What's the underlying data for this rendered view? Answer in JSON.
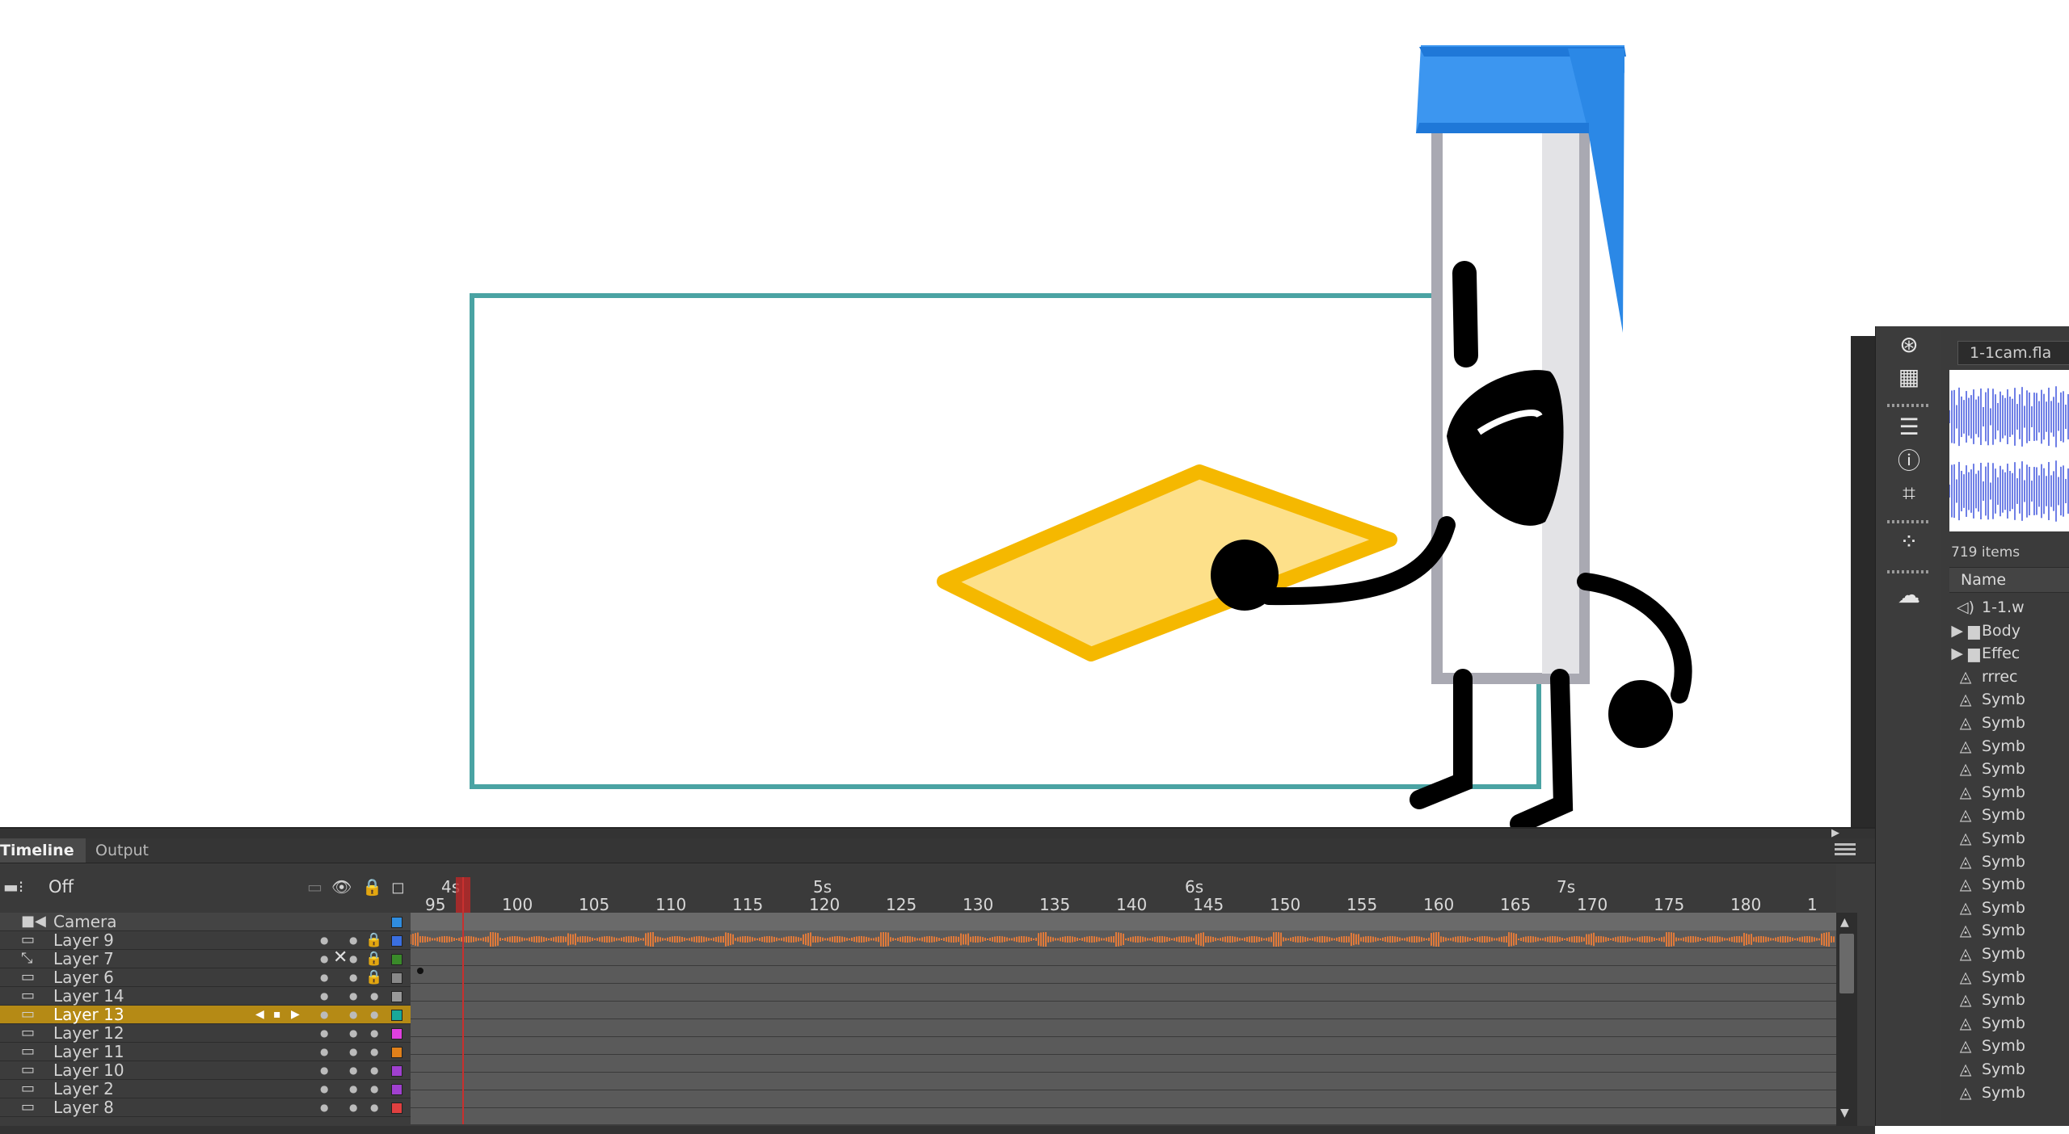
{
  "timeline": {
    "tabs": [
      "Timeline",
      "Output"
    ],
    "camera_toggle": "Off",
    "seconds_labels": [
      "4s",
      "5s",
      "6s",
      "7s"
    ],
    "frame_labels": [
      "95",
      "100",
      "105",
      "110",
      "115",
      "120",
      "125",
      "130",
      "135",
      "140",
      "145",
      "150",
      "155",
      "160",
      "165",
      "170",
      "175",
      "180",
      "1"
    ],
    "layers": [
      {
        "name": "Camera",
        "color": "#2f8de0"
      },
      {
        "name": "Layer 9",
        "color": "#3a6fe0"
      },
      {
        "name": "Layer 7",
        "color": "#3a8a2a"
      },
      {
        "name": "Layer 6",
        "color": "#888888"
      },
      {
        "name": "Layer 14",
        "color": "#999999"
      },
      {
        "name": "Layer 13",
        "color": "#19a89a"
      },
      {
        "name": "Layer 12",
        "color": "#e040e0"
      },
      {
        "name": "Layer 11",
        "color": "#e0801a"
      },
      {
        "name": "Layer 10",
        "color": "#a040d0"
      },
      {
        "name": "Layer 2",
        "color": "#a040d0"
      },
      {
        "name": "Layer 8",
        "color": "#e04040"
      }
    ],
    "selected_layer": "Layer 13"
  },
  "library": {
    "file_name": "1-1cam.fla",
    "item_count": "719 items",
    "name_header": "Name",
    "items": [
      {
        "icon": "sound-icon",
        "label": "1-1.w"
      },
      {
        "icon": "folder-icon",
        "label": "Body"
      },
      {
        "icon": "folder-icon",
        "label": "Effec"
      },
      {
        "icon": "graphic-symbol-icon",
        "label": "rrrec"
      },
      {
        "icon": "graphic-symbol-icon",
        "label": "Symb"
      },
      {
        "icon": "graphic-symbol-icon",
        "label": "Symb"
      },
      {
        "icon": "graphic-symbol-icon",
        "label": "Symb"
      },
      {
        "icon": "graphic-symbol-icon",
        "label": "Symb"
      },
      {
        "icon": "graphic-symbol-icon",
        "label": "Symb"
      },
      {
        "icon": "graphic-symbol-icon",
        "label": "Symb"
      },
      {
        "icon": "graphic-symbol-icon",
        "label": "Symb"
      },
      {
        "icon": "graphic-symbol-icon",
        "label": "Symb"
      },
      {
        "icon": "graphic-symbol-icon",
        "label": "Symb"
      },
      {
        "icon": "graphic-symbol-icon",
        "label": "Symb"
      },
      {
        "icon": "graphic-symbol-icon",
        "label": "Symb"
      },
      {
        "icon": "graphic-symbol-icon",
        "label": "Symb"
      },
      {
        "icon": "graphic-symbol-icon",
        "label": "Symb"
      },
      {
        "icon": "graphic-symbol-icon",
        "label": "Symb"
      },
      {
        "icon": "graphic-symbol-icon",
        "label": "Symb"
      },
      {
        "icon": "graphic-symbol-icon",
        "label": "Symb"
      },
      {
        "icon": "graphic-symbol-icon",
        "label": "Symb"
      },
      {
        "icon": "graphic-symbol-icon",
        "label": "Symb"
      }
    ]
  },
  "side_tools": [
    "3d-view-icon",
    "grid-icon",
    "align-icon",
    "info-icon",
    "transform-icon",
    "motion-presets-icon",
    "creative-cloud-icon"
  ],
  "colors": {
    "panel": "#3c3c3c",
    "selected_layer": "#b58a15",
    "playhead": "#c8302f",
    "stage_frame": "#4aa3a3",
    "character_blue": "#2b88e6",
    "paper_yellow": "#f5b800"
  }
}
